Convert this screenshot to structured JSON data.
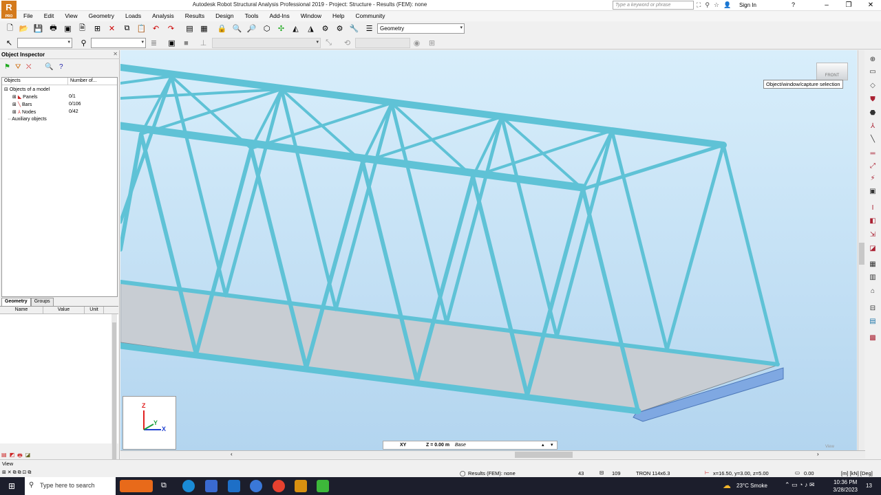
{
  "window": {
    "title": "Autodesk Robot Structural Analysis Professional 2019 - Project: Structure - Results (FEM): none",
    "logo_letter": "R",
    "logo_badge": "PRO",
    "search_placeholder": "Type a keyword or phrase",
    "sign_in": "Sign In",
    "help": "?"
  },
  "menu": [
    "File",
    "Edit",
    "View",
    "Geometry",
    "Loads",
    "Analysis",
    "Results",
    "Design",
    "Tools",
    "Add-Ins",
    "Window",
    "Help",
    "Community"
  ],
  "toolbar": {
    "layout_combo": "Geometry"
  },
  "object_inspector": {
    "title": "Object Inspector",
    "col_objects": "Objects",
    "col_number": "Number of...",
    "root": "Objects of a model",
    "items": [
      {
        "label": "Panels",
        "count": "0/1"
      },
      {
        "label": "Bars",
        "count": "0/106"
      },
      {
        "label": "Nodes",
        "count": "0/42"
      }
    ],
    "auxiliary": "Auxiliary objects",
    "tabs": [
      "Geometry",
      "Groups"
    ],
    "prop_cols": [
      "Name",
      "Value",
      "Unit"
    ]
  },
  "viewport": {
    "tooltip": "Object/window/capture selection",
    "viewcube_label": "FRONT",
    "axis_z": "Z",
    "axis_y": "Y",
    "axis_x": "X",
    "plane": "XY",
    "level": "Z = 0.00 m",
    "level_name": "Base",
    "view_label": "View"
  },
  "status": {
    "view": "View",
    "results": "Results (FEM): none",
    "node_count": "43",
    "bar_count": "109",
    "section": "TRON 114x6.3",
    "coords": "x=16.50, y=3.00, z=5.00",
    "angle": "0.00",
    "units": "[m] [kN] [Deg]"
  },
  "taskbar": {
    "search": "Type here to search",
    "weather": "23°C  Smoke",
    "time": "10:36 PM",
    "date": "3/28/2023",
    "notif": "13"
  }
}
